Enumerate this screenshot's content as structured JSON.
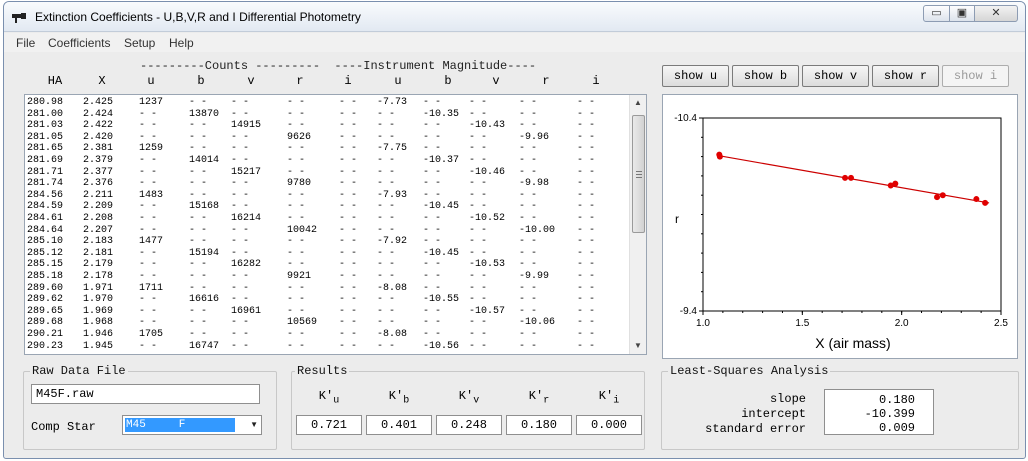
{
  "window": {
    "title": "Extinction Coefficients - U,B,V,R and I Differential Photometry",
    "minimize": "▭",
    "maximize": "▣",
    "close": "✕"
  },
  "menu": [
    "File",
    "Coefficients",
    "Setup",
    "Help"
  ],
  "table": {
    "group_header": "---------Counts ---------  ----Instrument Magnitude----",
    "columns": [
      "HA",
      "X",
      "u",
      "b",
      "v",
      "r",
      "i",
      "u",
      "b",
      "v",
      "r",
      "i"
    ],
    "rows": [
      [
        "280.98",
        "2.425",
        "1237",
        "- -",
        "- -",
        "- -",
        "- -",
        "-7.73",
        "- -",
        "- -",
        "- -",
        "- -"
      ],
      [
        "281.00",
        "2.424",
        "- -",
        "13870",
        "- -",
        "- -",
        "- -",
        "- -",
        "-10.35",
        "- -",
        "- -",
        "- -"
      ],
      [
        "281.03",
        "2.422",
        "- -",
        "- -",
        "14915",
        "- -",
        "- -",
        "- -",
        "- -",
        "-10.43",
        "- -",
        "- -"
      ],
      [
        "281.05",
        "2.420",
        "- -",
        "- -",
        "- -",
        "9626",
        "- -",
        "- -",
        "- -",
        "- -",
        "-9.96",
        "- -"
      ],
      [
        "281.65",
        "2.381",
        "1259",
        "- -",
        "- -",
        "- -",
        "- -",
        "-7.75",
        "- -",
        "- -",
        "- -",
        "- -"
      ],
      [
        "281.69",
        "2.379",
        "- -",
        "14014",
        "- -",
        "- -",
        "- -",
        "- -",
        "-10.37",
        "- -",
        "- -",
        "- -"
      ],
      [
        "281.71",
        "2.377",
        "- -",
        "- -",
        "15217",
        "- -",
        "- -",
        "- -",
        "- -",
        "-10.46",
        "- -",
        "- -"
      ],
      [
        "281.74",
        "2.376",
        "- -",
        "- -",
        "- -",
        "9780",
        "- -",
        "- -",
        "- -",
        "- -",
        "-9.98",
        "- -"
      ],
      [
        "284.56",
        "2.211",
        "1483",
        "- -",
        "- -",
        "- -",
        "- -",
        "-7.93",
        "- -",
        "- -",
        "- -",
        "- -"
      ],
      [
        "284.59",
        "2.209",
        "- -",
        "15168",
        "- -",
        "- -",
        "- -",
        "- -",
        "-10.45",
        "- -",
        "- -",
        "- -"
      ],
      [
        "284.61",
        "2.208",
        "- -",
        "- -",
        "16214",
        "- -",
        "- -",
        "- -",
        "- -",
        "-10.52",
        "- -",
        "- -"
      ],
      [
        "284.64",
        "2.207",
        "- -",
        "- -",
        "- -",
        "10042",
        "- -",
        "- -",
        "- -",
        "- -",
        "-10.00",
        "- -"
      ],
      [
        "285.10",
        "2.183",
        "1477",
        "- -",
        "- -",
        "- -",
        "- -",
        "-7.92",
        "- -",
        "- -",
        "- -",
        "- -"
      ],
      [
        "285.12",
        "2.181",
        "- -",
        "15194",
        "- -",
        "- -",
        "- -",
        "- -",
        "-10.45",
        "- -",
        "- -",
        "- -"
      ],
      [
        "285.15",
        "2.179",
        "- -",
        "- -",
        "16282",
        "- -",
        "- -",
        "- -",
        "- -",
        "-10.53",
        "- -",
        "- -"
      ],
      [
        "285.18",
        "2.178",
        "- -",
        "- -",
        "- -",
        "9921",
        "- -",
        "- -",
        "- -",
        "- -",
        "-9.99",
        "- -"
      ],
      [
        "289.60",
        "1.971",
        "1711",
        "- -",
        "- -",
        "- -",
        "- -",
        "-8.08",
        "- -",
        "- -",
        "- -",
        "- -"
      ],
      [
        "289.62",
        "1.970",
        "- -",
        "16616",
        "- -",
        "- -",
        "- -",
        "- -",
        "-10.55",
        "- -",
        "- -",
        "- -"
      ],
      [
        "289.65",
        "1.969",
        "- -",
        "- -",
        "16961",
        "- -",
        "- -",
        "- -",
        "- -",
        "-10.57",
        "- -",
        "- -"
      ],
      [
        "289.68",
        "1.968",
        "- -",
        "- -",
        "- -",
        "10569",
        "- -",
        "- -",
        "- -",
        "- -",
        "-10.06",
        "- -"
      ],
      [
        "290.21",
        "1.946",
        "1705",
        "- -",
        "- -",
        "- -",
        "- -",
        "-8.08",
        "- -",
        "- -",
        "- -",
        "- -"
      ],
      [
        "290.23",
        "1.945",
        "- -",
        "16747",
        "- -",
        "- -",
        "- -",
        "- -",
        "-10.56",
        "- -",
        "- -",
        "- -"
      ]
    ]
  },
  "show_buttons": [
    "show u",
    "show b",
    "show v",
    "show r",
    "show i"
  ],
  "show_buttons_enabled": [
    true,
    true,
    true,
    true,
    false
  ],
  "raw_data": {
    "label": "Raw Data File",
    "file": "M45F.raw",
    "comp_label": "Comp Star",
    "comp_value": "M45     F"
  },
  "results": {
    "label": "Results",
    "k_labels": [
      {
        "base": "K'",
        "sub": "u"
      },
      {
        "base": "K'",
        "sub": "b"
      },
      {
        "base": "K'",
        "sub": "v"
      },
      {
        "base": "K'",
        "sub": "r"
      },
      {
        "base": "K'",
        "sub": "i"
      }
    ],
    "k_values": [
      "0.721",
      "0.401",
      "0.248",
      "0.180",
      "0.000"
    ]
  },
  "lsa": {
    "label": "Least-Squares Analysis",
    "slope_label": "slope",
    "intercept_label": "intercept",
    "stderr_label": "standard error",
    "slope": "0.180",
    "intercept": "-10.399",
    "stderr": "0.009"
  },
  "colors": {
    "point": "#e00000",
    "line": "#cc0000",
    "selection": "#3399ff"
  },
  "chart_data": {
    "type": "scatter",
    "xlabel": "X  (air mass)",
    "ylabel": "r",
    "xlim": [
      1.0,
      2.5
    ],
    "ylim": [
      -9.4,
      -10.4
    ],
    "y_inverted": true,
    "x_ticks": [
      "1.0",
      "1.5",
      "2.0",
      "2.5"
    ],
    "y_ticks": [
      "-10.4",
      "-9.4"
    ],
    "fit_line": {
      "slope": 0.18,
      "intercept": -10.399
    },
    "points": [
      {
        "x": 2.42,
        "y": -9.96
      },
      {
        "x": 2.376,
        "y": -9.98
      },
      {
        "x": 2.207,
        "y": -10.0
      },
      {
        "x": 2.178,
        "y": -9.99
      },
      {
        "x": 1.968,
        "y": -10.06
      },
      {
        "x": 1.945,
        "y": -10.05
      },
      {
        "x": 1.745,
        "y": -10.09
      },
      {
        "x": 1.715,
        "y": -10.09
      },
      {
        "x": 1.085,
        "y": -10.2
      },
      {
        "x": 1.082,
        "y": -10.21
      }
    ]
  }
}
